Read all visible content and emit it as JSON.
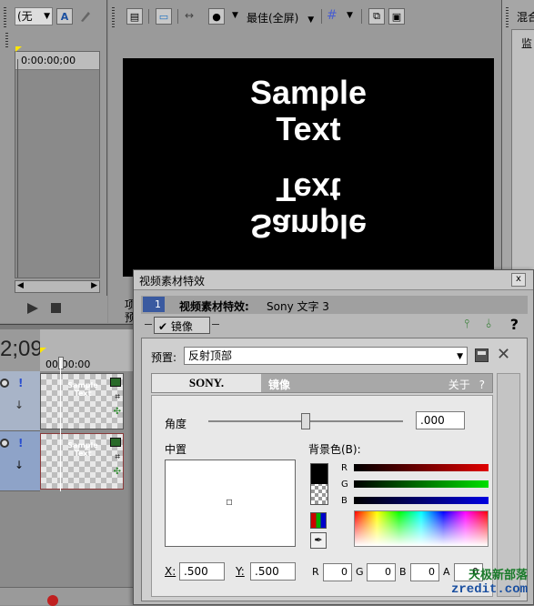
{
  "left_panel": {
    "dropdown_value": "(无",
    "timecode": "0:00:00;00"
  },
  "preview_toolbar": {
    "quality_label": "最佳(全屏)"
  },
  "preview_text": {
    "line1": "Sample",
    "line2": "Text",
    "mirror_line1": "Text",
    "mirror_line2": "Sample"
  },
  "right_panel": {
    "tab_top": "混合",
    "tab_label": "监"
  },
  "timeline": {
    "time_display": "2;09",
    "ruler_time": "00:00:00",
    "clip1_text": "Sample Text",
    "clip2_text": "Sample Text",
    "left_labels": [
      "项",
      "预"
    ]
  },
  "dialog": {
    "title": "视频素材特效",
    "close_symbol": "x",
    "tab_number": "1",
    "header_text": "视频素材特效:",
    "header_value": "Sony 文字 3",
    "chain_item_label": "镜像",
    "help_symbol": "?",
    "preset_label": "预置:",
    "preset_value": "反射顶部",
    "plugin_brand": "SONY.",
    "plugin_name": "镜像",
    "about_label": "关于",
    "about_help": "?",
    "angle_label": "角度",
    "angle_value": ".000",
    "angle_slider_level": 0.5,
    "center_label": "中置",
    "center_marker": "▫",
    "bgcolor_label": "背景色(B):",
    "r_label": "R",
    "g_label": "G",
    "b_label": "B",
    "x_label": "X:",
    "x_value": ".500",
    "y_label": "Y:",
    "y_value": ".500",
    "rgba": [
      {
        "label": "R",
        "value": "0"
      },
      {
        "label": "G",
        "value": "0"
      },
      {
        "label": "B",
        "value": "0"
      },
      {
        "label": "A",
        "value": "0"
      }
    ]
  },
  "watermark": {
    "line1": "天极新部落",
    "line2": "zredit.com"
  },
  "colors": {
    "dialog_title_bg": "#c8c8c8",
    "preview_bg": "#000000",
    "red": "#e00000",
    "green": "#00c000",
    "blue": "#0000e0"
  }
}
